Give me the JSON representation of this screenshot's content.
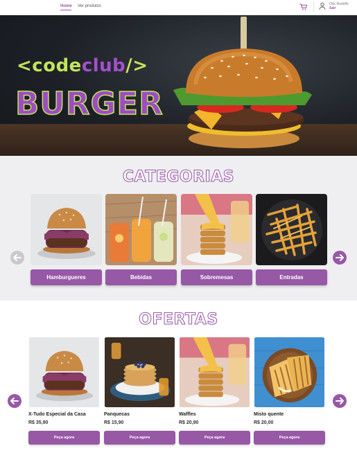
{
  "header": {
    "nav_home": "Home",
    "nav_products": "Ver produtos",
    "greeting": "Olá, Rodolfo",
    "logout": "Sair",
    "accent_color": "#9758a6"
  },
  "hero": {
    "logo_lt": "<",
    "logo_code": "code",
    "logo_club": "club",
    "logo_slash": "/>",
    "logo_burger": "BURGER"
  },
  "categories": {
    "title": "CATEGORIAS",
    "items": [
      {
        "label": "Hamburgueres",
        "image": "burger"
      },
      {
        "label": "Bebidas",
        "image": "drinks"
      },
      {
        "label": "Sobremesas",
        "image": "dessert"
      },
      {
        "label": "Entradas",
        "image": "fries"
      }
    ],
    "prev_icon": "arrow-left-icon",
    "next_icon": "arrow-right-icon"
  },
  "offers": {
    "title": "OFERTAS",
    "items": [
      {
        "name": "X-Tudo Especial da Casa",
        "price": "R$ 35,90",
        "button": "Peça agora",
        "image": "burger"
      },
      {
        "name": "Panquecas",
        "price": "R$ 15,90",
        "button": "Peça agora",
        "image": "pancakes"
      },
      {
        "name": "Waffles",
        "price": "R$ 20,90",
        "button": "Peça agora",
        "image": "waffles"
      },
      {
        "name": "Misto quente",
        "price": "R$ 20,00",
        "button": "Peça agora",
        "image": "toast"
      }
    ]
  }
}
